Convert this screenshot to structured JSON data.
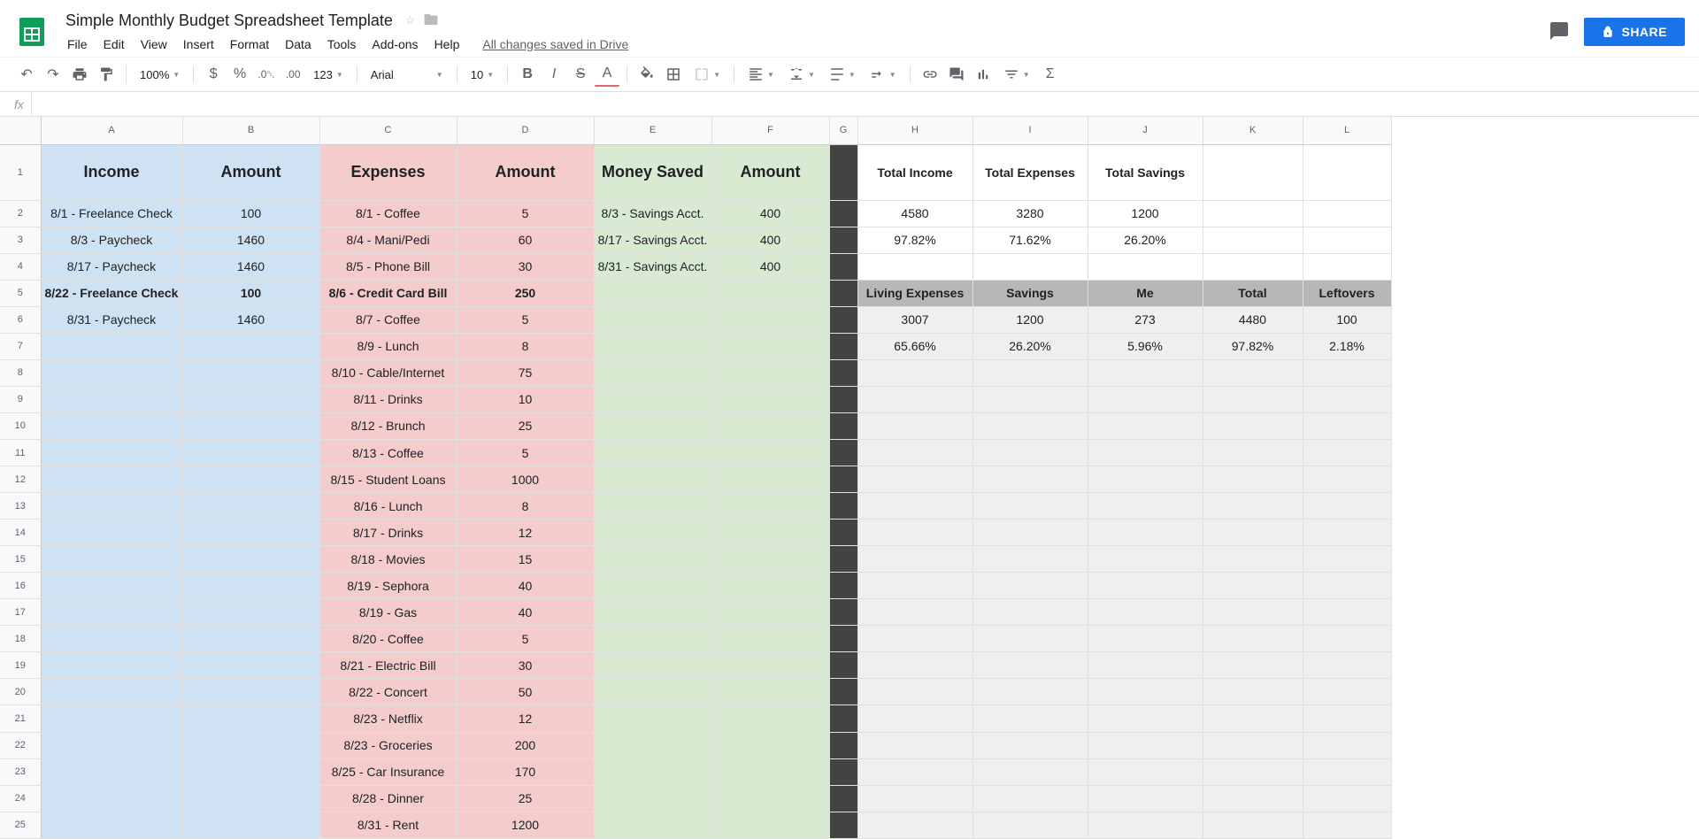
{
  "doc": {
    "title": "Simple Monthly Budget Spreadsheet Template",
    "saveStatus": "All changes saved in Drive"
  },
  "menus": [
    "File",
    "Edit",
    "View",
    "Insert",
    "Format",
    "Data",
    "Tools",
    "Add-ons",
    "Help"
  ],
  "share": "SHARE",
  "toolbar": {
    "zoom": "100%",
    "fmt": "123",
    "font": "Arial",
    "size": "10"
  },
  "colLetters": [
    "A",
    "B",
    "C",
    "D",
    "E",
    "F",
    "G",
    "H",
    "I",
    "J",
    "K",
    "L"
  ],
  "headers": {
    "income": "Income",
    "amount1": "Amount",
    "expenses": "Expenses",
    "amount2": "Amount",
    "money": "Money Saved",
    "amount3": "Amount",
    "tIncome": "Total Income",
    "tExp": "Total Expenses",
    "tSav": "Total Savings",
    "living": "Living Expenses",
    "savings": "Savings",
    "me": "Me",
    "total": "Total",
    "leftovers": "Leftovers"
  },
  "income": [
    {
      "desc": "8/1 - Freelance Check",
      "amt": "100"
    },
    {
      "desc": "8/3 - Paycheck",
      "amt": "1460"
    },
    {
      "desc": "8/17 - Paycheck",
      "amt": "1460"
    },
    {
      "desc": "8/22 - Freelance Check",
      "amt": "100"
    },
    {
      "desc": "8/31 - Paycheck",
      "amt": "1460"
    }
  ],
  "expenses": [
    {
      "desc": "8/1 - Coffee",
      "amt": "5"
    },
    {
      "desc": "8/4 - Mani/Pedi",
      "amt": "60"
    },
    {
      "desc": "8/5 - Phone Bill",
      "amt": "30"
    },
    {
      "desc": "8/6 - Credit Card Bill",
      "amt": "250"
    },
    {
      "desc": "8/7 - Coffee",
      "amt": "5"
    },
    {
      "desc": "8/9 - Lunch",
      "amt": "8"
    },
    {
      "desc": "8/10 - Cable/Internet",
      "amt": "75"
    },
    {
      "desc": "8/11 - Drinks",
      "amt": "10"
    },
    {
      "desc": "8/12 - Brunch",
      "amt": "25"
    },
    {
      "desc": "8/13 - Coffee",
      "amt": "5"
    },
    {
      "desc": "8/15 - Student Loans",
      "amt": "1000"
    },
    {
      "desc": "8/16 - Lunch",
      "amt": "8"
    },
    {
      "desc": "8/17 - Drinks",
      "amt": "12"
    },
    {
      "desc": "8/18 - Movies",
      "amt": "15"
    },
    {
      "desc": "8/19 - Sephora",
      "amt": "40"
    },
    {
      "desc": "8/19 - Gas",
      "amt": "40"
    },
    {
      "desc": "8/20 - Coffee",
      "amt": "5"
    },
    {
      "desc": "8/21 - Electric Bill",
      "amt": "30"
    },
    {
      "desc": "8/22 - Concert",
      "amt": "50"
    },
    {
      "desc": "8/23 - Netflix",
      "amt": "12"
    },
    {
      "desc": "8/23 - Groceries",
      "amt": "200"
    },
    {
      "desc": "8/25 - Car Insurance",
      "amt": "170"
    },
    {
      "desc": "8/28 - Dinner",
      "amt": "25"
    },
    {
      "desc": "8/31 - Rent",
      "amt": "1200"
    }
  ],
  "saved": [
    {
      "desc": "8/3 - Savings Acct.",
      "amt": "400"
    },
    {
      "desc": "8/17 - Savings Acct.",
      "amt": "400"
    },
    {
      "desc": "8/31 - Savings Acct.",
      "amt": "400"
    }
  ],
  "totals1": {
    "income": "4580",
    "exp": "3280",
    "sav": "1200"
  },
  "totals2": {
    "income": "97.82%",
    "exp": "71.62%",
    "sav": "26.20%"
  },
  "summary2a": {
    "living": "3007",
    "sav": "1200",
    "me": "273",
    "total": "4480",
    "left": "100"
  },
  "summary2b": {
    "living": "65.66%",
    "sav": "26.20%",
    "me": "5.96%",
    "total": "97.82%",
    "left": "2.18%"
  }
}
